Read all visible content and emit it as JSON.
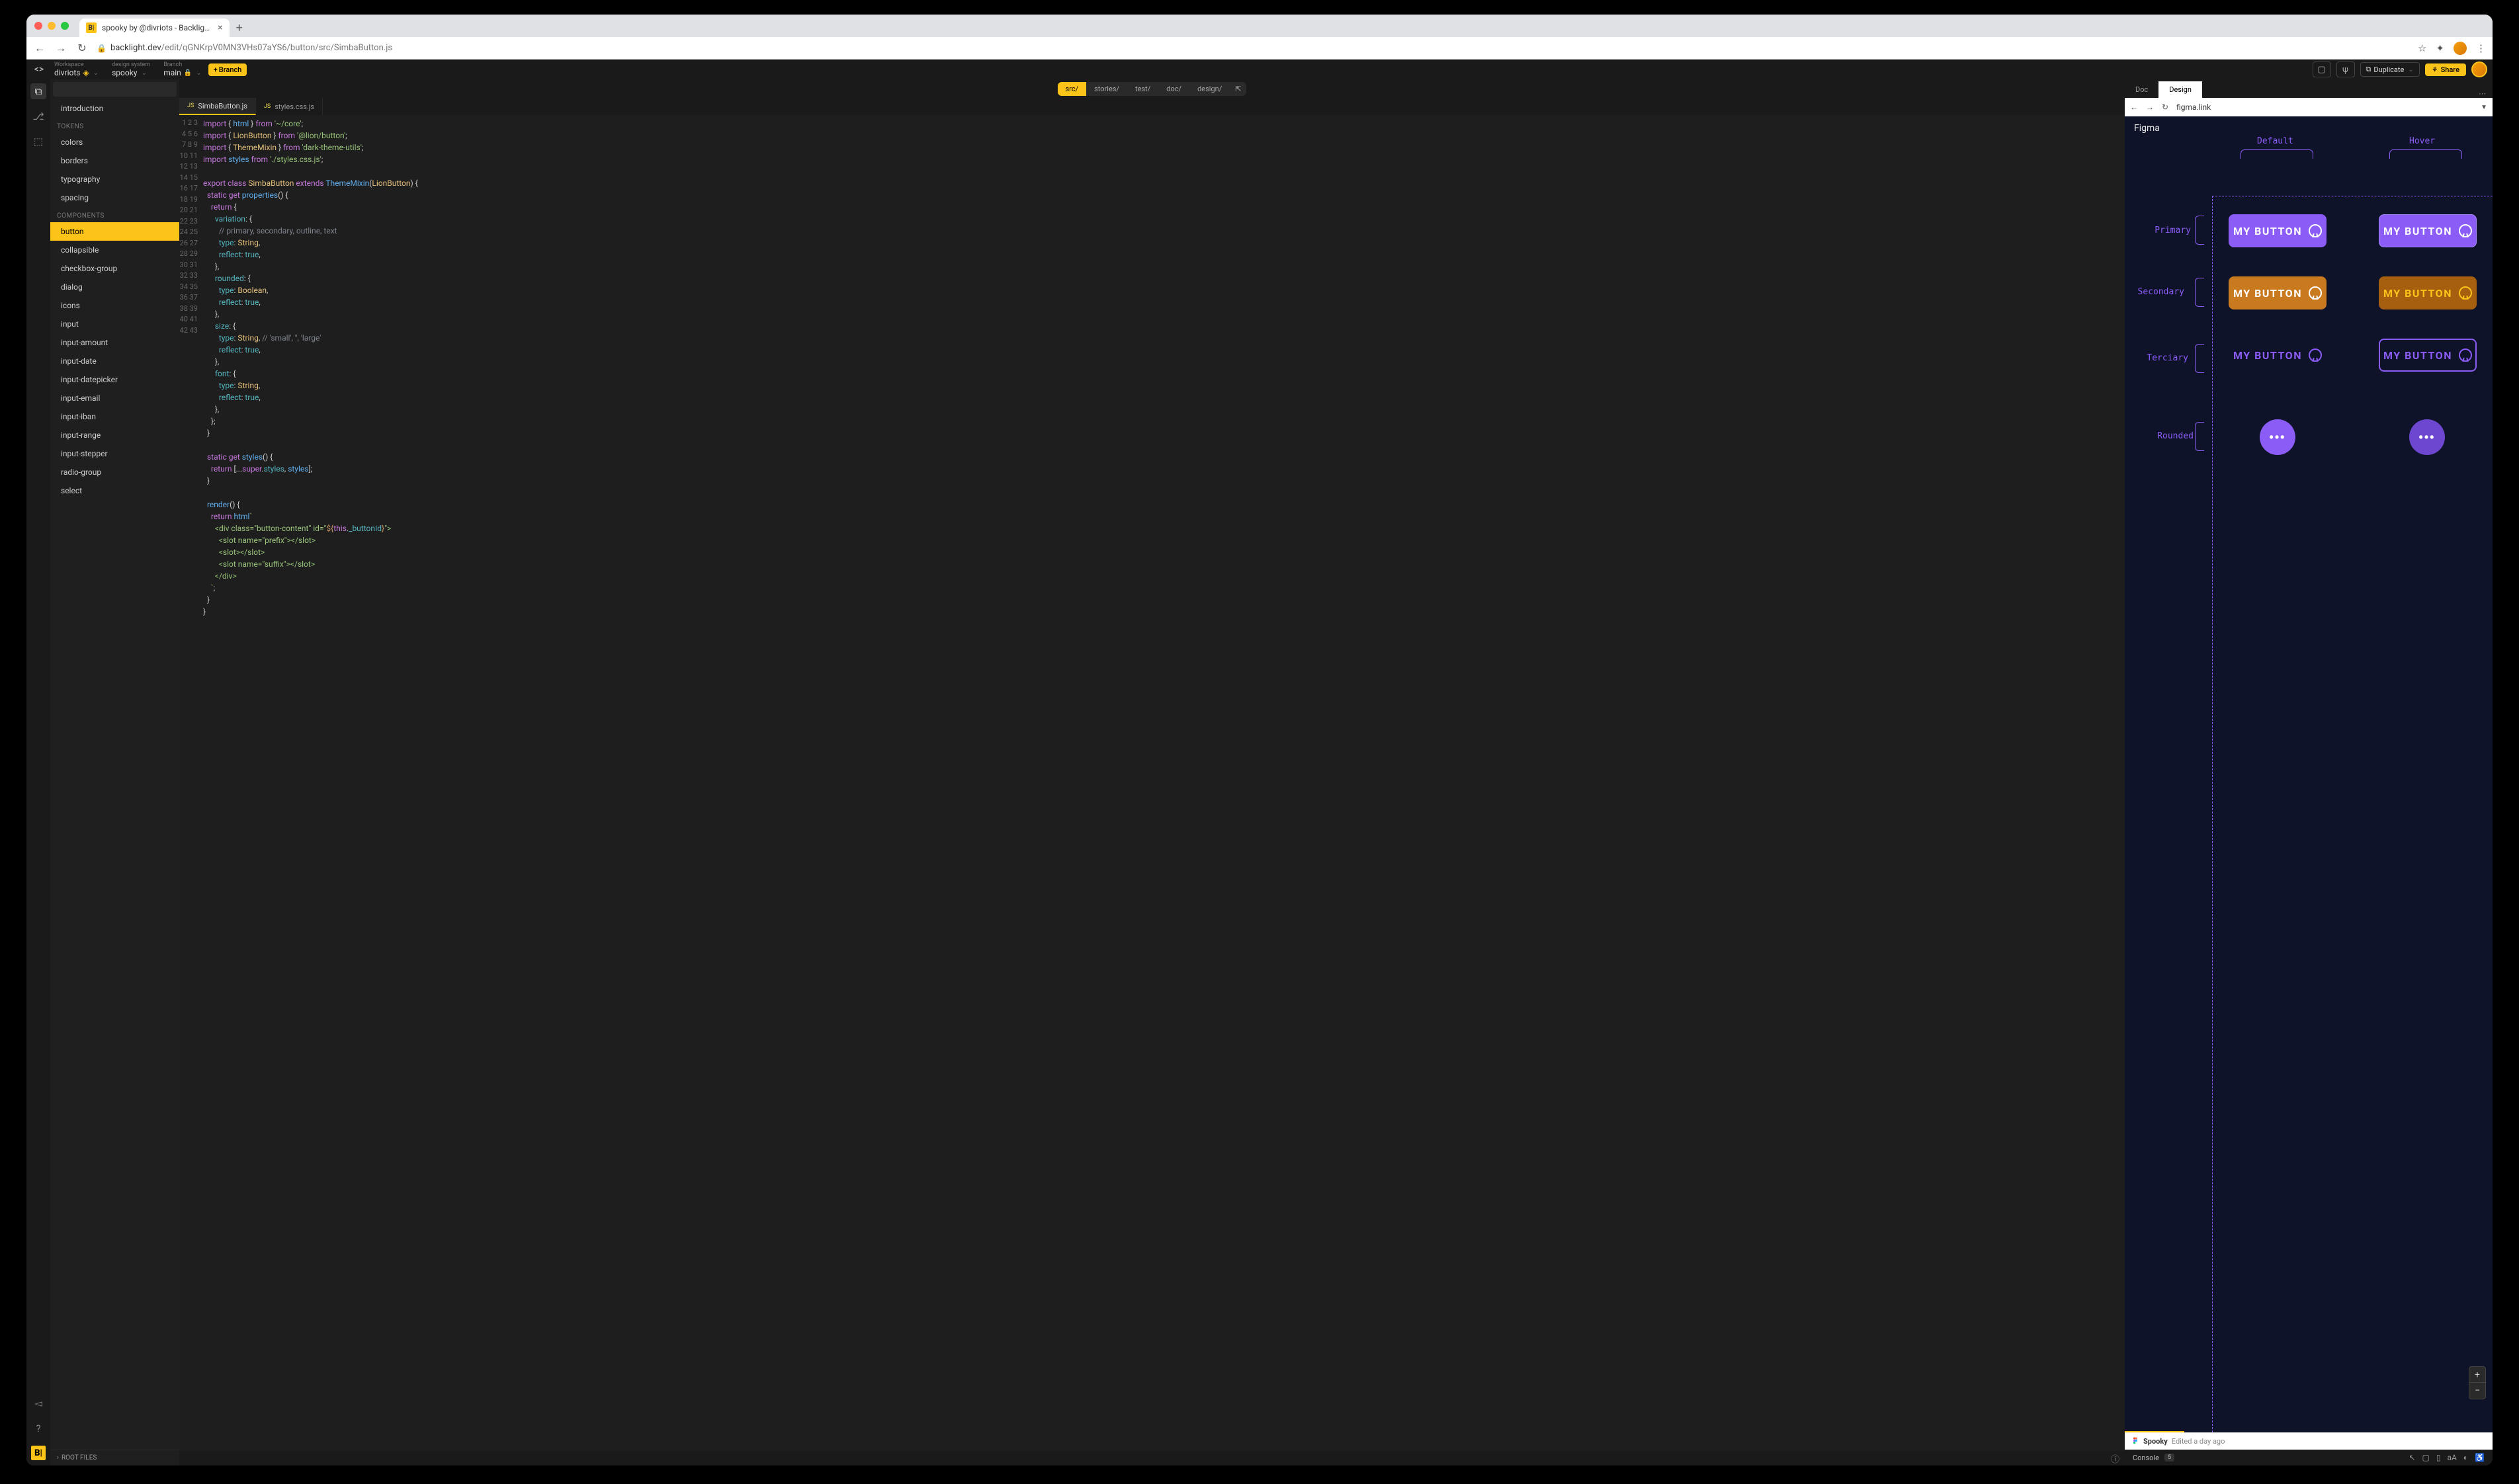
{
  "browser": {
    "tab_title": "spooky by @divriots - Backlig…",
    "favicon_text": "B|",
    "url_host": "backlight.dev",
    "url_path": "/edit/qGNKrpV0MN3VHs07aYS6/button/src/SimbaButton.js"
  },
  "topbar": {
    "workspace_label": "Workspace",
    "workspace_value": "divriots",
    "ds_label": "design system",
    "ds_value": "spooky",
    "branch_label": "Branch",
    "branch_value": "main",
    "branch_button": "Branch",
    "duplicate": "Duplicate",
    "share": "Share"
  },
  "sidebar": {
    "intro": "introduction",
    "tokens_header": "TOKENS",
    "tokens": [
      "colors",
      "borders",
      "typography",
      "spacing"
    ],
    "components_header": "COMPONENTS",
    "components": [
      "button",
      "collapsible",
      "checkbox-group",
      "dialog",
      "icons",
      "input",
      "input-amount",
      "input-date",
      "input-datepicker",
      "input-email",
      "input-iban",
      "input-range",
      "input-stepper",
      "radio-group",
      "select"
    ],
    "selected": "button",
    "root_files": "ROOT FILES"
  },
  "path_tabs": [
    "src/",
    "stories/",
    "test/",
    "doc/",
    "design/"
  ],
  "path_active": "src/",
  "file_tabs": [
    {
      "name": "SimbaButton.js",
      "active": true
    },
    {
      "name": "styles.css.js",
      "active": false
    }
  ],
  "code_lines": 43,
  "right": {
    "tabs": [
      "Doc",
      "Design"
    ],
    "active": "Design",
    "url": "figma.link"
  },
  "figma": {
    "title": "Figma",
    "col_default": "Default",
    "col_hover": "Hover",
    "rows": [
      "Primary",
      "Secondary",
      "Terciary",
      "Rounded"
    ],
    "button_text": "MY BUTTON",
    "round_text": "•••",
    "info_name": "Spooky",
    "info_time": "Edited a day ago"
  },
  "console": {
    "label": "Console",
    "count": "5"
  }
}
